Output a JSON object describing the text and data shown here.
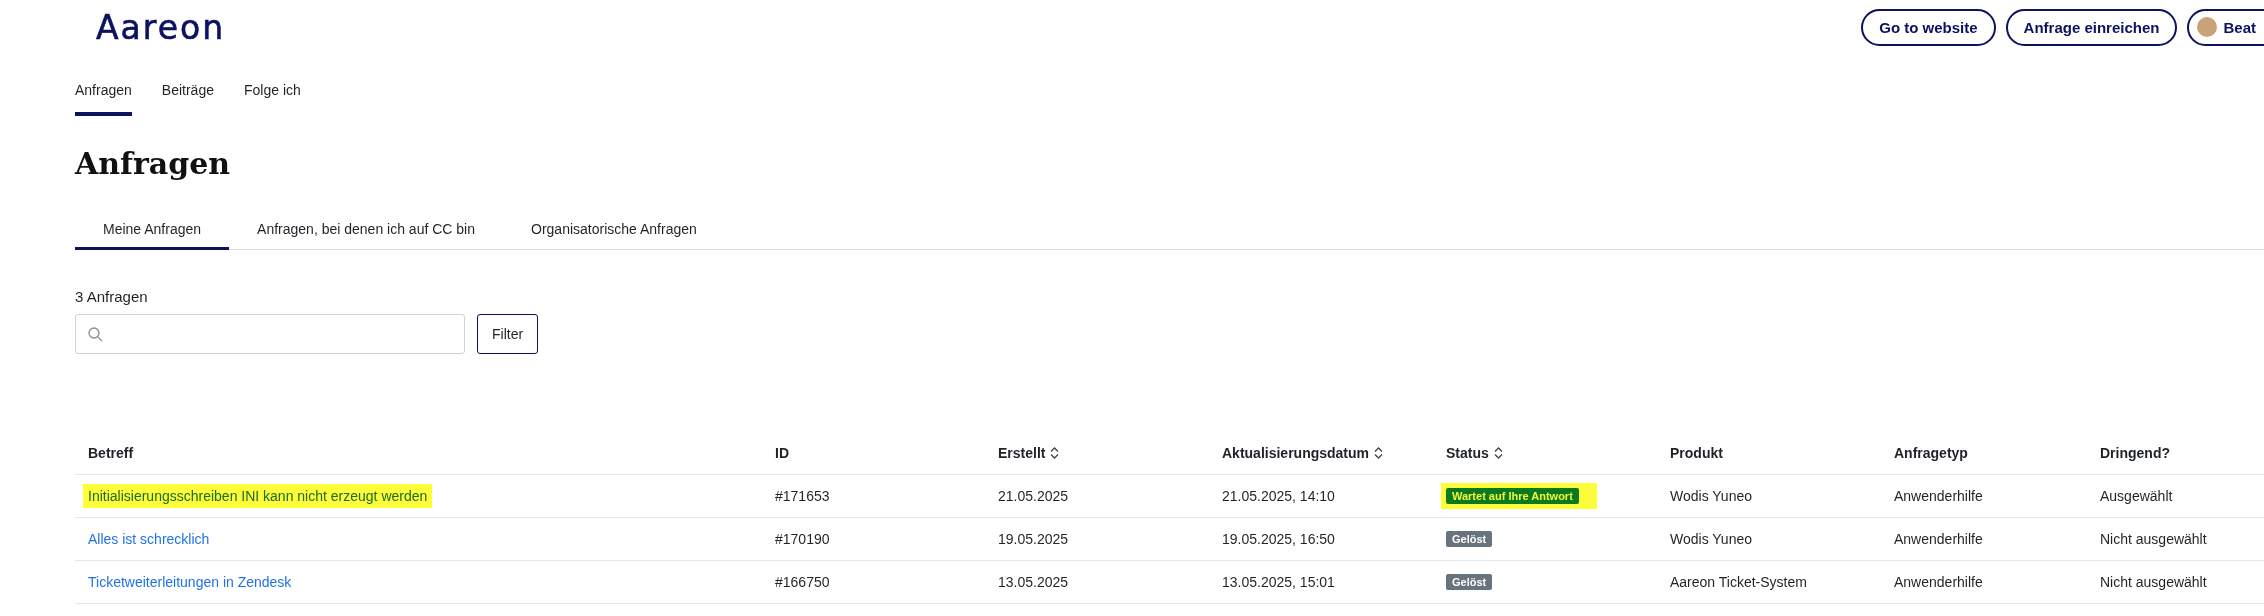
{
  "header": {
    "logo": "Aareon",
    "buttons": [
      "Go to website",
      "Anfrage einreichen"
    ],
    "user": {
      "name": "Beat"
    }
  },
  "nav": [
    {
      "label": "Anfragen",
      "selected": true
    },
    {
      "label": "Beiträge",
      "selected": false
    },
    {
      "label": "Folge ich",
      "selected": false
    }
  ],
  "title": "Anfragen",
  "tabs": [
    {
      "label": "Meine Anfragen",
      "selected": true
    },
    {
      "label": "Anfragen, bei denen ich auf CC bin",
      "selected": false
    },
    {
      "label": "Organisatorische Anfragen",
      "selected": false
    }
  ],
  "count": "3 Anfragen",
  "filter_button": "Filter",
  "table": {
    "columns": [
      {
        "label": "Betreff",
        "sortable": false
      },
      {
        "label": "ID",
        "sortable": false
      },
      {
        "label": "Erstellt",
        "sortable": true
      },
      {
        "label": "Aktualisierungsdatum",
        "sortable": true
      },
      {
        "label": "Status",
        "sortable": true
      },
      {
        "label": "Produkt",
        "sortable": false
      },
      {
        "label": "Anfragetyp",
        "sortable": false
      },
      {
        "label": "Dringend?",
        "sortable": false
      }
    ],
    "rows": [
      {
        "subject": "Initialisierungsschreiben INI kann nicht erzeugt werden",
        "id": "#171653",
        "created": "21.05.2025",
        "updated": "21.05.2025, 14:10",
        "status": {
          "label": "Wartet auf Ihre Antwort",
          "color": "#0b7a1e"
        },
        "product": "Wodis Yuneo",
        "type": "Anwenderhilfe",
        "urgent": "Ausgewählt",
        "highlighted": true
      },
      {
        "subject": "Alles ist schrecklich",
        "id": "#170190",
        "created": "19.05.2025",
        "updated": "19.05.2025, 16:50",
        "status": {
          "label": "Gelöst",
          "color": "#68737d"
        },
        "product": "Wodis Yuneo",
        "type": "Anwenderhilfe",
        "urgent": "Nicht ausgewählt",
        "highlighted": false
      },
      {
        "subject": "Ticketweiterleitungen in Zendesk",
        "id": "#166750",
        "created": "13.05.2025",
        "updated": "13.05.2025, 15:01",
        "status": {
          "label": "Gelöst",
          "color": "#68737d"
        },
        "product": "Aareon Ticket-System",
        "type": "Anwenderhilfe",
        "urgent": "Nicht ausgewählt",
        "highlighted": false
      }
    ]
  }
}
